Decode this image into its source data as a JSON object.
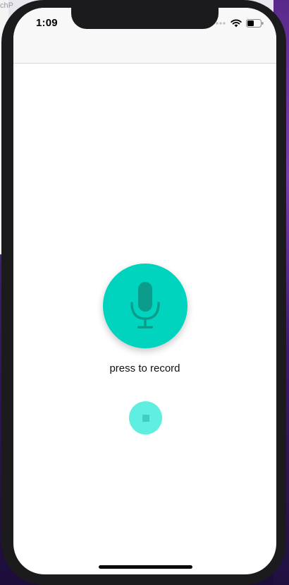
{
  "status_bar": {
    "time": "1:09",
    "icons": [
      "signal-dots-icon",
      "wifi-icon",
      "battery-icon"
    ]
  },
  "background": {
    "partial_text": "chP"
  },
  "recorder": {
    "mic_icon": "microphone-icon",
    "label": "press to record",
    "stop_icon": "stop-icon"
  },
  "colors": {
    "mic_button": "#00d4bf",
    "stop_button": "#5feee0",
    "mic_glyph": "#0b9c8c"
  }
}
